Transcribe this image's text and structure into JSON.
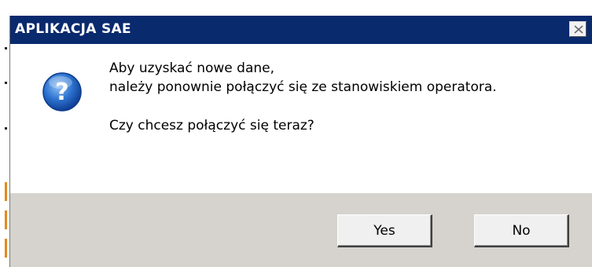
{
  "dialog": {
    "title": "APLIKACJA SAE",
    "close_icon": "close-icon",
    "message_icon": "question-icon",
    "message_line1": "Aby uzyskać nowe dane,",
    "message_line2": "należy ponownie połączyć się ze stanowiskiem operatora.",
    "question": "Czy chcesz połączyć się teraz?",
    "buttons": {
      "yes": "Yes",
      "no": "No"
    }
  },
  "colors": {
    "titlebar": "#0a2a6e",
    "footer": "#d6d3ce",
    "icon_blue": "#1f5fbf"
  }
}
